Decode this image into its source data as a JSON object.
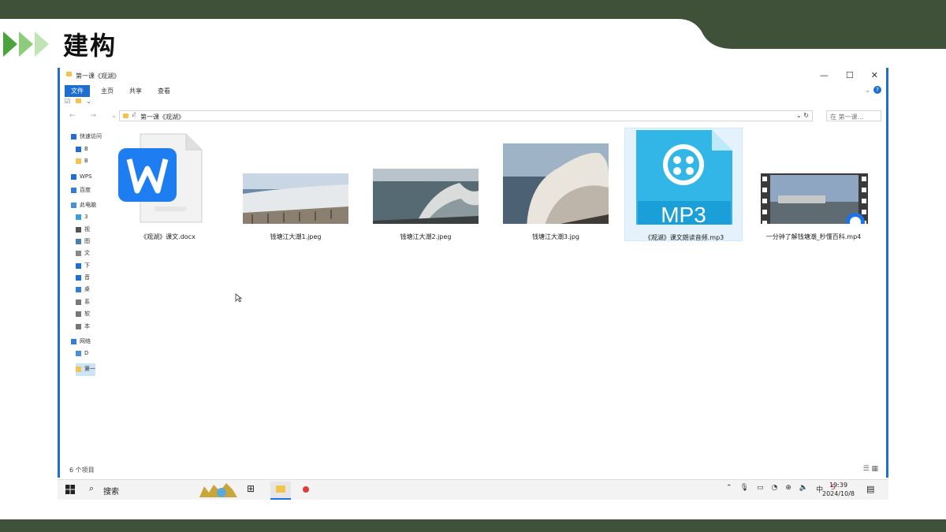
{
  "slide": {
    "heading": "建构",
    "colors": {
      "band": "#3f5139",
      "chevron_dark": "#4aa33c",
      "chevron_light": "#a8d49a"
    }
  },
  "window": {
    "title": "第一课《观湖》",
    "controls": {
      "minimize": "—",
      "maximize": "☐",
      "close": "✕"
    },
    "ribbon_tabs": [
      "文件",
      "主页",
      "共享",
      "查看"
    ],
    "address_path": "第一课《观湖》",
    "search_placeholder": "在 第一课...",
    "sidebar_items": [
      {
        "label": "快速访问",
        "icon": "star-icon"
      },
      {
        "label": "B",
        "icon": "pin-icon"
      },
      {
        "label": "B",
        "icon": "folder-icon"
      },
      {
        "label": "WPS",
        "icon": "cloud-icon"
      },
      {
        "label": "百度",
        "icon": "app-icon"
      },
      {
        "label": "此电脑",
        "icon": "computer-icon"
      },
      {
        "label": "3",
        "icon": "cube-icon"
      },
      {
        "label": "视",
        "icon": "video-icon"
      },
      {
        "label": "图",
        "icon": "picture-icon"
      },
      {
        "label": "文",
        "icon": "document-icon"
      },
      {
        "label": "下",
        "icon": "download-icon"
      },
      {
        "label": "音",
        "icon": "music-icon"
      },
      {
        "label": "桌",
        "icon": "desktop-icon"
      },
      {
        "label": "系",
        "icon": "drive-icon"
      },
      {
        "label": "软",
        "icon": "drive-icon"
      },
      {
        "label": "本",
        "icon": "drive-icon"
      },
      {
        "label": "网络",
        "icon": "network-icon"
      },
      {
        "label": "D",
        "icon": "computer-icon"
      },
      {
        "label": "第一",
        "icon": "folder-icon"
      }
    ],
    "files": [
      {
        "name": "《观湖》课文.docx",
        "type": "docx"
      },
      {
        "name": "钱塘江大潮1.jpeg",
        "type": "image"
      },
      {
        "name": "钱塘江大潮2.jpeg",
        "type": "image"
      },
      {
        "name": "钱塘江大潮3.jpg",
        "type": "image"
      },
      {
        "name": "《观湖》课文朗读音频.mp3",
        "type": "mp3",
        "badge": "MP3"
      },
      {
        "name": "一分钟了解钱塘潮_秒懂百科.mp4",
        "type": "video"
      }
    ],
    "status": "6 个项目"
  },
  "taskbar": {
    "search_label": "搜索",
    "time": "19:39",
    "date": "2024/10/8"
  }
}
